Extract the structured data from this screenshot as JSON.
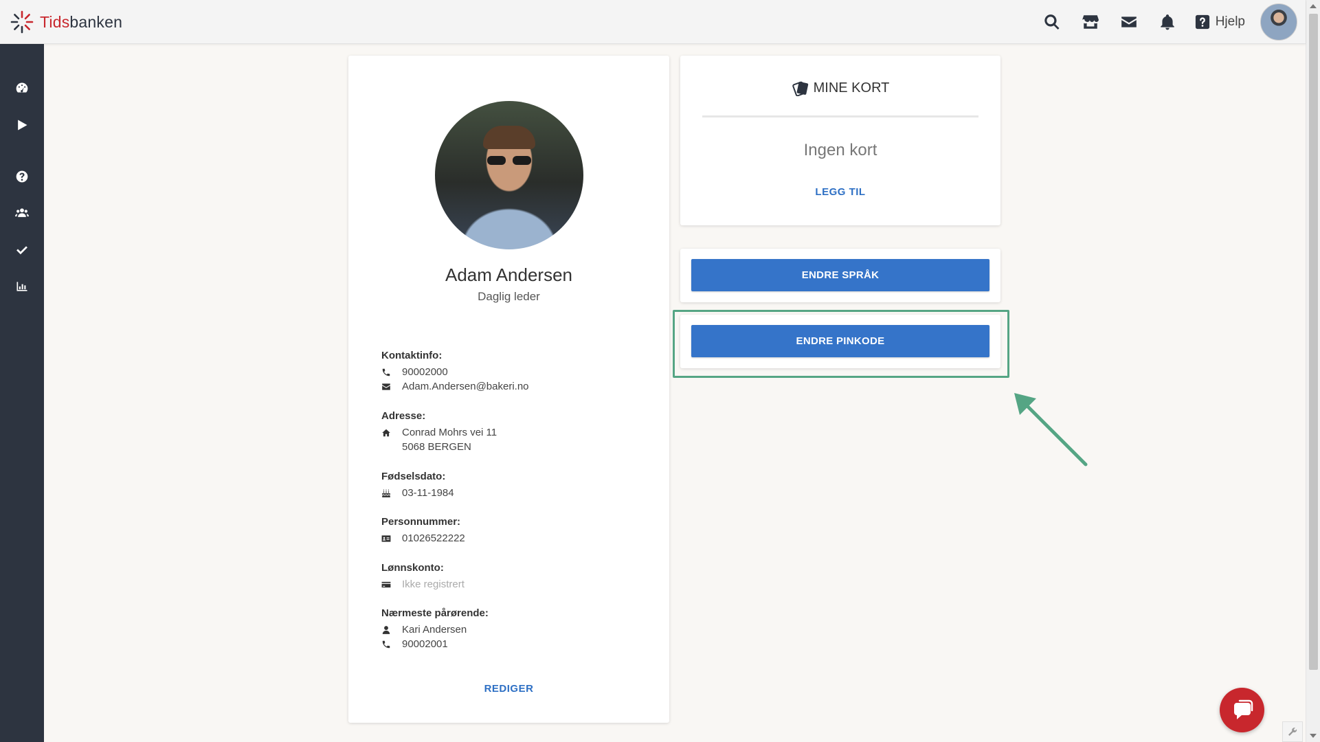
{
  "header": {
    "logo_part1": "Tids",
    "logo_part2": "banken",
    "icons": [
      "search-icon",
      "store-icon",
      "mail-icon",
      "bell-icon",
      "help-icon"
    ],
    "help_label": "Hjelp"
  },
  "sidebar": {
    "items": [
      "dashboard-icon",
      "play-icon",
      "question-icon",
      "users-icon",
      "check-icon",
      "chart-icon"
    ]
  },
  "profile": {
    "name": "Adam Andersen",
    "role": "Daglig leder",
    "contact_label": "Kontaktinfo:",
    "phone": "90002000",
    "email": "Adam.Andersen@bakeri.no",
    "address_label": "Adresse:",
    "address_line1": "Conrad Mohrs vei 11",
    "address_line2": "5068 BERGEN",
    "birth_label": "Fødselsdato:",
    "birth_date": "03-11-1984",
    "personal_number_label": "Personnummer:",
    "personal_number": "01026522222",
    "bank_label": "Lønnskonto:",
    "bank_value": "Ikke registrert",
    "next_of_kin_label": "Nærmeste pårørende:",
    "next_of_kin_name": "Kari Andersen",
    "next_of_kin_phone": "90002001",
    "edit_label": "REDIGER"
  },
  "cards": {
    "title": "MINE KORT",
    "empty_text": "Ingen kort",
    "add_label": "LEGG TIL"
  },
  "actions": {
    "change_language": "ENDRE SPRÅK",
    "change_pin": "ENDRE PINKODE"
  },
  "colors": {
    "primary": "#3574c9",
    "sidebar": "#2d3440",
    "brand_red": "#c8272d",
    "highlight": "#55a584"
  }
}
